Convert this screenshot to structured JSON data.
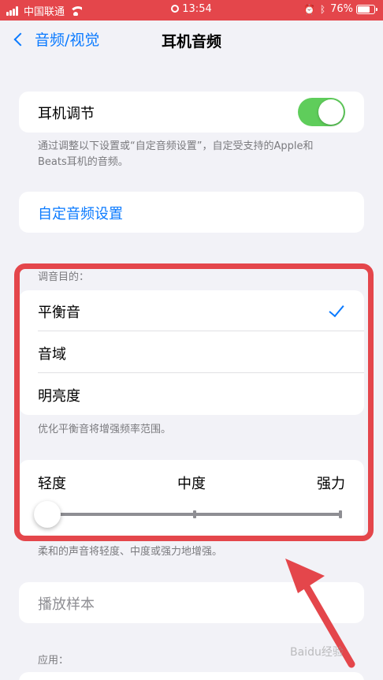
{
  "status_bar": {
    "carrier": "中国联通",
    "time": "13:54",
    "battery": "76%",
    "battery_level": 0.76
  },
  "nav": {
    "back_label": "音频/视觉",
    "title": "耳机音频"
  },
  "headphone_adjust": {
    "label": "耳机调节",
    "enabled": true,
    "footnote": "通过调整以下设置或“自定音频设置”，自定受支持的Apple和Beats耳机的音频。"
  },
  "custom_setup": {
    "label": "自定音频设置"
  },
  "tune_for": {
    "header": "调音目的：",
    "options": [
      "平衡音",
      "音域",
      "明亮度"
    ],
    "selected": 0,
    "footnote": "优化平衡音将增强频率范围。"
  },
  "strength": {
    "labels": [
      "轻度",
      "中度",
      "强力"
    ],
    "value": 0,
    "footnote": "柔和的声音将轻度、中度或强力地增强。"
  },
  "play_sample": {
    "label": "播放样本"
  },
  "apply_header": "应用：",
  "colors": {
    "accent": "#0a7aff",
    "toggle_on": "#5fcd5b",
    "highlight": "#e4464b"
  },
  "watermark": "Baidu经验"
}
